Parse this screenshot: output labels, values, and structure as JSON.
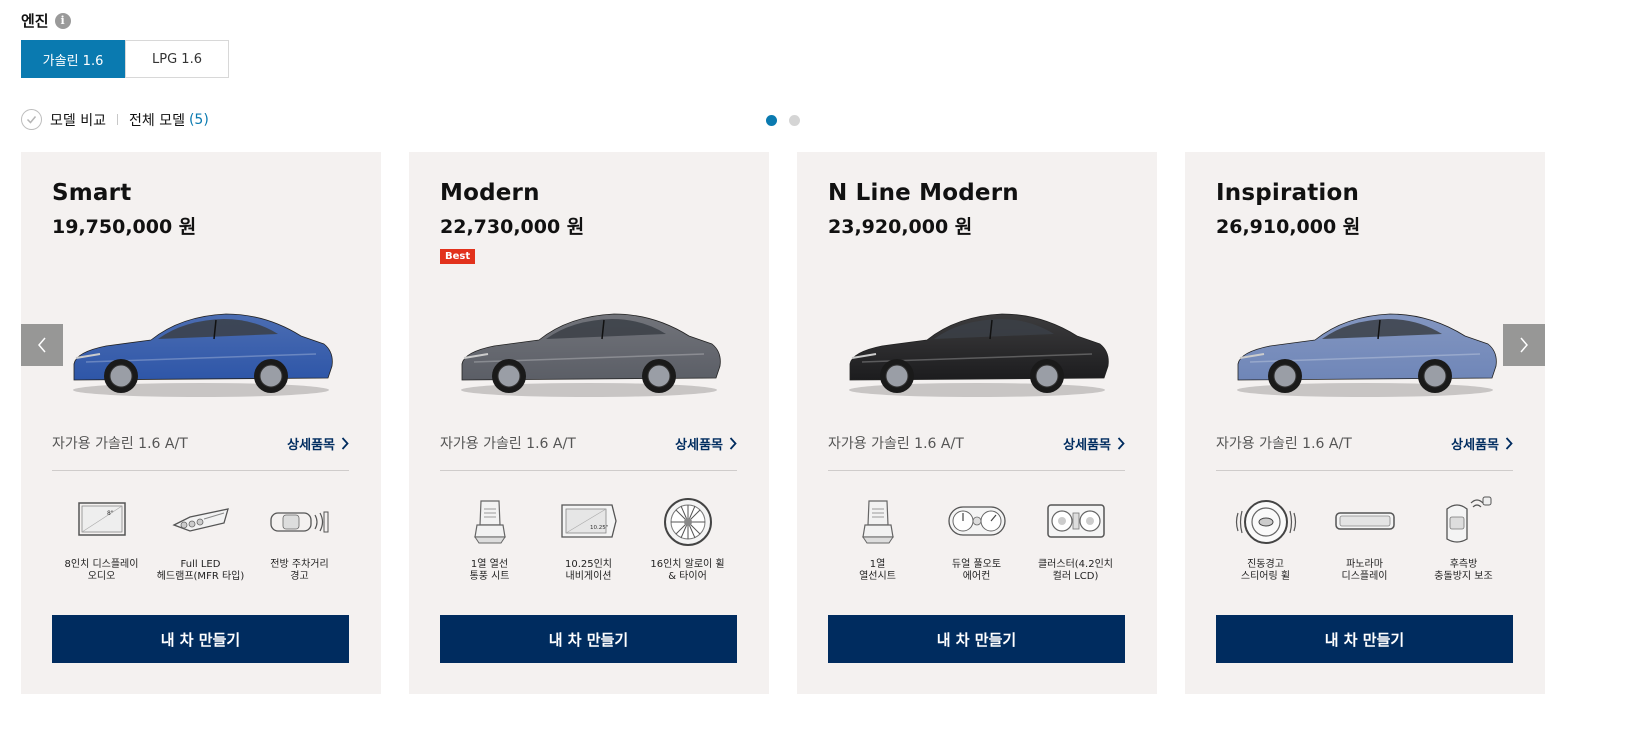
{
  "engine": {
    "title": "엔진",
    "info_icon": "info-icon",
    "tabs": [
      {
        "label": "가솔린 1.6",
        "active": true
      },
      {
        "label": "LPG 1.6",
        "active": false
      }
    ]
  },
  "compare": {
    "label": "모델 비교",
    "all_models_label": "전체 모델",
    "count": "(5)"
  },
  "pagination": {
    "pages": 2,
    "current": 1
  },
  "colors": {
    "accent": "#0a7ab0",
    "button": "#002c5f",
    "card_bg": "#f4f1f0",
    "badge": "#e2321c"
  },
  "cards": [
    {
      "name": "Smart",
      "price": "19,750,000 원",
      "badge": "",
      "car_color": "#2e56a8",
      "spec": "자가용 가솔린 1.6 A/T",
      "detail_label": "상세품목",
      "features": [
        {
          "icon": "display-icon",
          "label": "8인치 디스플레이\n오디오"
        },
        {
          "icon": "headlamp-icon",
          "label": "Full LED\n헤드램프(MFR 타입)"
        },
        {
          "icon": "parking-sensor-icon",
          "label": "전방 주차거리\n경고"
        }
      ],
      "button_label": "내 차 만들기"
    },
    {
      "name": "Modern",
      "price": "22,730,000 원",
      "badge": "Best",
      "car_color": "#5b5e66",
      "spec": "자가용 가솔린 1.6 A/T",
      "detail_label": "상세품목",
      "features": [
        {
          "icon": "seat-icon",
          "label": "1열 열선\n통풍 시트"
        },
        {
          "icon": "navigation-icon",
          "label": "10.25인치\n내비게이션"
        },
        {
          "icon": "wheel-icon",
          "label": "16인치 알로이 휠\n& 타이어"
        }
      ],
      "button_label": "내 차 만들기"
    },
    {
      "name": "N Line Modern",
      "price": "23,920,000 원",
      "badge": "",
      "car_color": "#1c1c1e",
      "spec": "자가용 가솔린 1.6 A/T",
      "detail_label": "상세품목",
      "features": [
        {
          "icon": "seat-icon",
          "label": "1열\n열선시트"
        },
        {
          "icon": "climate-control-icon",
          "label": "듀얼 풀오토\n에어컨"
        },
        {
          "icon": "cluster-icon",
          "label": "클러스터(4.2인치\n컬러 LCD)"
        }
      ],
      "button_label": "내 차 만들기"
    },
    {
      "name": "Inspiration",
      "price": "26,910,000 원",
      "badge": "",
      "car_color": "#6f86b8",
      "spec": "자가용 가솔린 1.6 A/T",
      "detail_label": "상세품목",
      "features": [
        {
          "icon": "steering-wheel-icon",
          "label": "진동경고\n스티어링 휠"
        },
        {
          "icon": "panorama-display-icon",
          "label": "파노라마\n디스플레이"
        },
        {
          "icon": "rear-collision-icon",
          "label": "후측방\n충돌방지 보조"
        }
      ],
      "button_label": "내 차 만들기"
    }
  ],
  "nav": {
    "prev_icon": "chevron-left-icon",
    "next_icon": "chevron-right-icon"
  }
}
